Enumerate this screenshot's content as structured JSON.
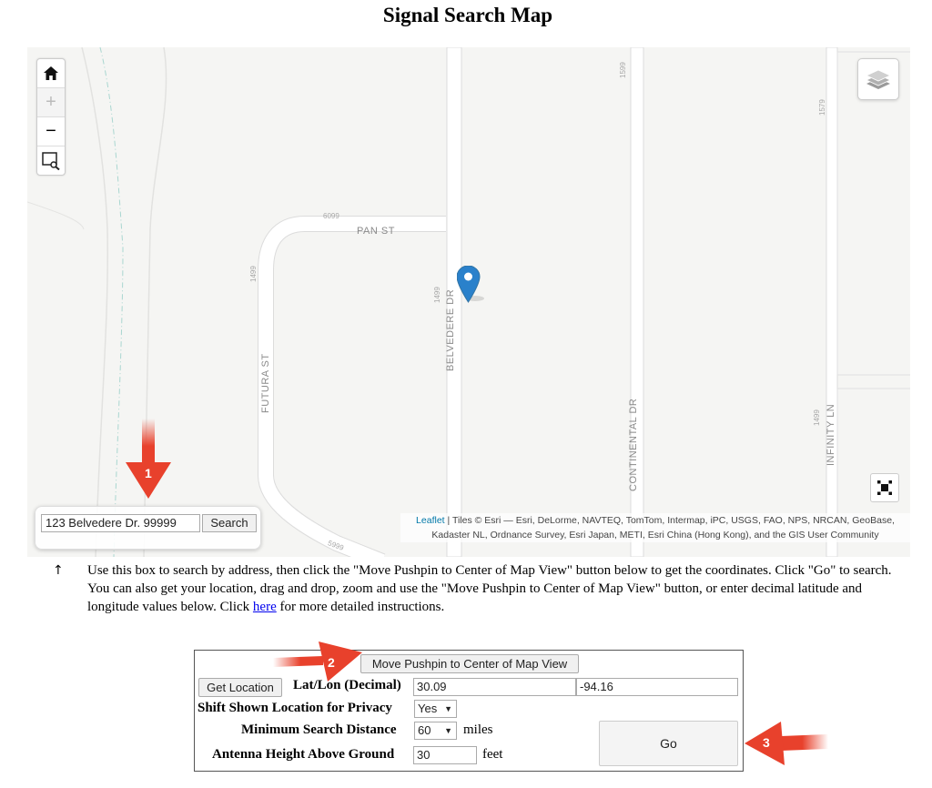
{
  "page": {
    "title": "Signal Search Map"
  },
  "map": {
    "controls": {
      "home_icon": "home-icon",
      "zoom_in": "+",
      "zoom_out": "−",
      "box_zoom_icon": "box-zoom-icon",
      "layers_icon": "layers-icon",
      "fullscreen_icon": "fullscreen-icon"
    },
    "roads": {
      "pan_st": "PAN ST",
      "futura_st": "FUTURA ST",
      "belvedere_dr": "BELVEDERE DR",
      "continental_dr": "CONTINENTAL DR",
      "infinity_ln": "INFINITY LN"
    },
    "road_numbers": {
      "pan_top": "6099",
      "futura_top": "1499",
      "belvedere": "1499",
      "top_middle": "1599",
      "top_right": "1579",
      "infinity": "1499",
      "bottom_curve": "5999"
    },
    "search": {
      "value": "123 Belvedere Dr. 99999",
      "button_label": "Search"
    },
    "attribution": {
      "link": "Leaflet",
      "text": " | Tiles © Esri — Esri, DeLorme, NAVTEQ, TomTom, Intermap, iPC, USGS, FAO, NPS, NRCAN, GeoBase, Kadaster NL, Ordnance Survey, Esri Japan, METI, Esri China (Hong Kong), and the GIS User Community"
    },
    "marker_color": "#2a81cb"
  },
  "callouts": {
    "one": "1",
    "two": "2",
    "three": "3",
    "color": "#e8412c"
  },
  "instructions": {
    "arrow": "↑",
    "line1": "Use this box to search by address, then click the \"Move Pushpin to Center of Map View\" button below to get the coordinates. Click \"Go\" to search.",
    "line2_pre": "You can also get your location, drag and drop, zoom and use the \"Move Pushpin to Center of Map View\" button, or enter decimal latitude and longitude values below. Click ",
    "link": "here",
    "line2_post": " for more detailed instructions."
  },
  "form": {
    "move_pushpin_label": "Move Pushpin to Center of Map View",
    "get_location_label": "Get Location",
    "latlon_label": "Lat/Lon (Decimal)",
    "lat_value": "30.09",
    "lon_value": "-94.16",
    "privacy_label": "Shift Shown Location for Privacy",
    "privacy_value": "Yes",
    "distance_label": "Minimum Search Distance",
    "distance_value": "60",
    "distance_unit": "miles",
    "antenna_label": "Antenna Height Above Ground",
    "antenna_value": "30",
    "antenna_unit": "feet",
    "go_label": "Go"
  }
}
